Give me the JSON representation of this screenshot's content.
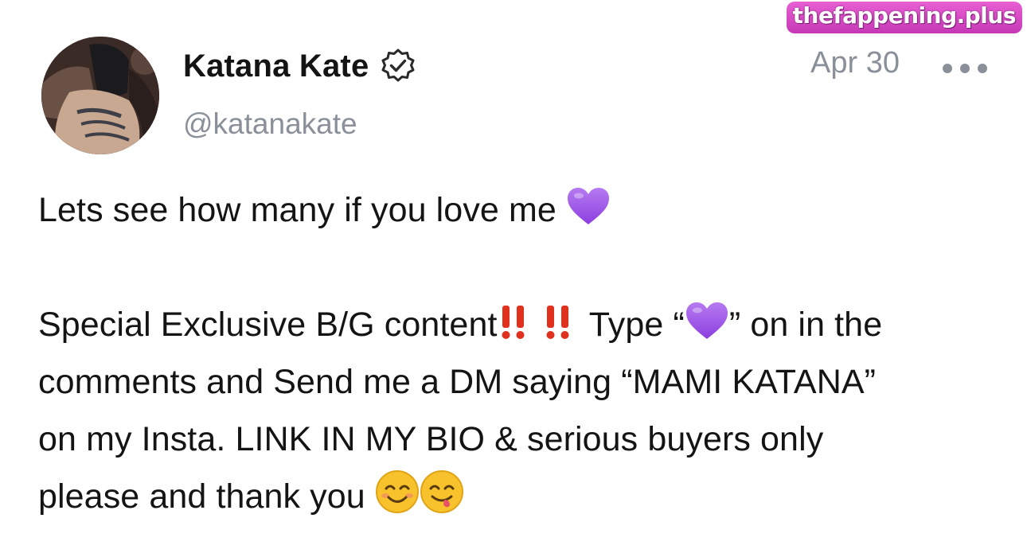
{
  "watermark": "thefappening.plus",
  "post": {
    "author": {
      "display_name": "Katana Kate",
      "handle": "@katanakate",
      "verified": true
    },
    "date": "Apr 30",
    "body": {
      "line1": "Lets see how many if you love me",
      "para2_part1": "Special Exclusive B/G content",
      "para2_part2": " Type “",
      "para2_part3": "” on in the",
      "para2_line2": "comments and Send me a DM saying “MAMI KATANA”",
      "para2_line3": "on my Insta. LINK IN MY BIO & serious buyers only",
      "para2_line4": "please and thank you"
    }
  },
  "icons": {
    "verified": "verified-badge-icon",
    "more": "more-options-icon",
    "heart": "purple-heart-emoji",
    "bang": "double-exclamation-emoji",
    "smile": "smiling-face-emoji",
    "yum": "savoring-food-face-emoji"
  },
  "colors": {
    "text": "#141414",
    "muted": "#8a9099",
    "heart": "#a259e8",
    "exclamation": "#e0301e",
    "emoji_face": "#f8c22d",
    "watermark": "#d14bc2"
  }
}
